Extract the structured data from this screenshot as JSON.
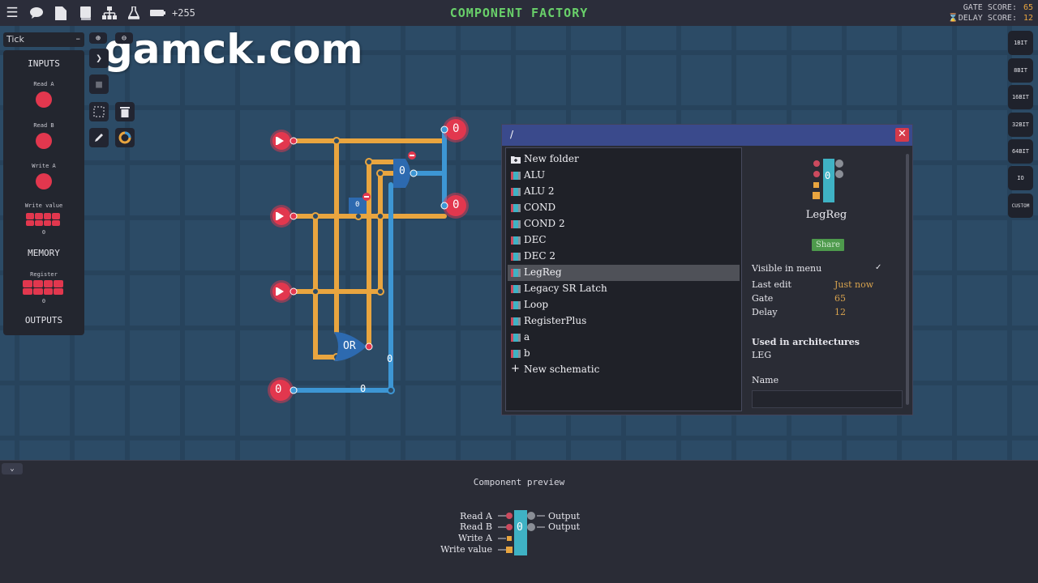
{
  "topbar": {
    "icons": [
      "menu-icon",
      "chat-icon",
      "document-icon",
      "book-icon",
      "hierarchy-icon",
      "flask-icon",
      "battery-icon"
    ],
    "counter": "+255",
    "title": "COMPONENT FACTORY",
    "gate_score_label": "GATE SCORE:",
    "gate_score": "65",
    "delay_score_label": "DELAY SCORE:",
    "delay_score": "12"
  },
  "watermark": "gamck.com",
  "tick": {
    "label": "Tick",
    "dash": "–"
  },
  "palette": {
    "inputs_title": "INPUTS",
    "read_a": "Read A",
    "read_b": "Read B",
    "write_a": "Write A",
    "write_value": "Write value",
    "write_value_zero": "0",
    "memory_title": "MEMORY",
    "register": "Register",
    "register_zero": "0",
    "outputs_title": "OUTPUTS"
  },
  "right_buttons": [
    "1BIT",
    "8BIT",
    "16BIT",
    "32BIT",
    "64BIT",
    "IO",
    "CUSTOM"
  ],
  "circuit": {
    "values": [
      "0",
      "0",
      "0",
      "0",
      "0",
      "0",
      "0"
    ],
    "or_label": "OR"
  },
  "dialog": {
    "path": "/",
    "close": "✕",
    "items": [
      {
        "label": "New folder",
        "icon": "new-folder-icon"
      },
      {
        "label": "ALU",
        "icon": "component-icon"
      },
      {
        "label": "ALU 2",
        "icon": "component-icon"
      },
      {
        "label": "COND",
        "icon": "component-icon"
      },
      {
        "label": "COND 2",
        "icon": "component-icon"
      },
      {
        "label": "DEC",
        "icon": "component-icon"
      },
      {
        "label": "DEC 2",
        "icon": "component-icon"
      },
      {
        "label": "LegReg",
        "icon": "component-icon",
        "selected": true
      },
      {
        "label": "Legacy SR Latch",
        "icon": "component-icon"
      },
      {
        "label": "Loop",
        "icon": "component-icon"
      },
      {
        "label": "RegisterPlus",
        "icon": "component-icon"
      },
      {
        "label": "a",
        "icon": "component-icon"
      },
      {
        "label": "b",
        "icon": "component-icon"
      },
      {
        "label": "New schematic",
        "icon": "plus-icon"
      }
    ],
    "detail": {
      "name": "LegReg",
      "preview_value": "0",
      "share": "Share",
      "visible_in_menu": "Visible in menu",
      "checkmark": "✓",
      "last_edit_label": "Last edit",
      "last_edit_value": "Just now",
      "gate_label": "Gate",
      "gate_value": "65",
      "delay_label": "Delay",
      "delay_value": "12",
      "used_in": "Used in architectures",
      "used_in_value": "LEG",
      "name_label": "Name"
    }
  },
  "bottom": {
    "collapse": "⌄",
    "title": "Component preview",
    "inputs": [
      "Read A",
      "Read B",
      "Write A",
      "Write value"
    ],
    "outputs": [
      "Output",
      "Output"
    ],
    "value": "0"
  },
  "colors": {
    "orange_wire": "#e9a53f",
    "blue_wire": "#3d96d4",
    "pin_red": "#e2374e",
    "title_green": "#69d06a"
  }
}
